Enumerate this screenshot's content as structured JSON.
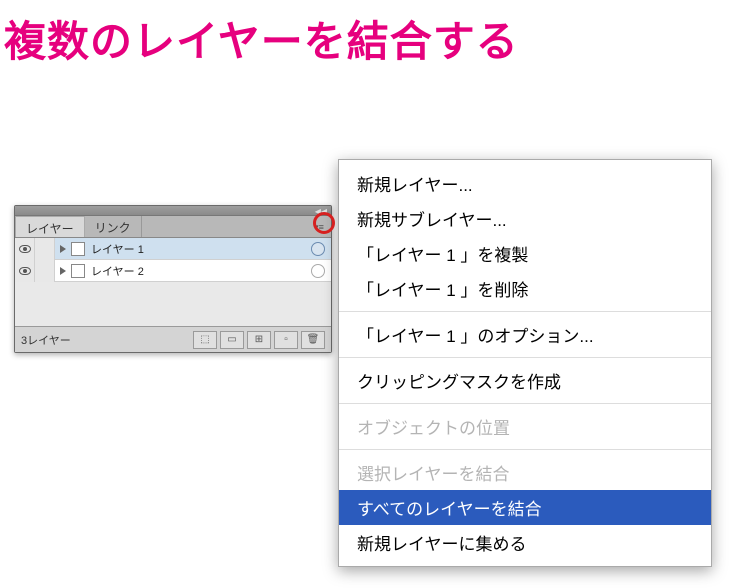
{
  "heading": "複数のレイヤーを結合する",
  "panel": {
    "tabs": {
      "layers": "レイヤー",
      "links": "リンク"
    },
    "rows": [
      {
        "name": "レイヤー 1",
        "selected": true
      },
      {
        "name": "レイヤー 2",
        "selected": false
      }
    ],
    "status": "3レイヤー"
  },
  "menu": {
    "new_layer": "新規レイヤー...",
    "new_sublayer": "新規サブレイヤー...",
    "duplicate": "「レイヤー 1 」を複製",
    "delete": "「レイヤー 1 」を削除",
    "options": "「レイヤー 1 」のオプション...",
    "clipmask": "クリッピングマスクを作成",
    "obj_pos": "オブジェクトの位置",
    "merge_selected": "選択レイヤーを結合",
    "merge_all": "すべてのレイヤーを結合",
    "collect": "新規レイヤーに集める"
  }
}
